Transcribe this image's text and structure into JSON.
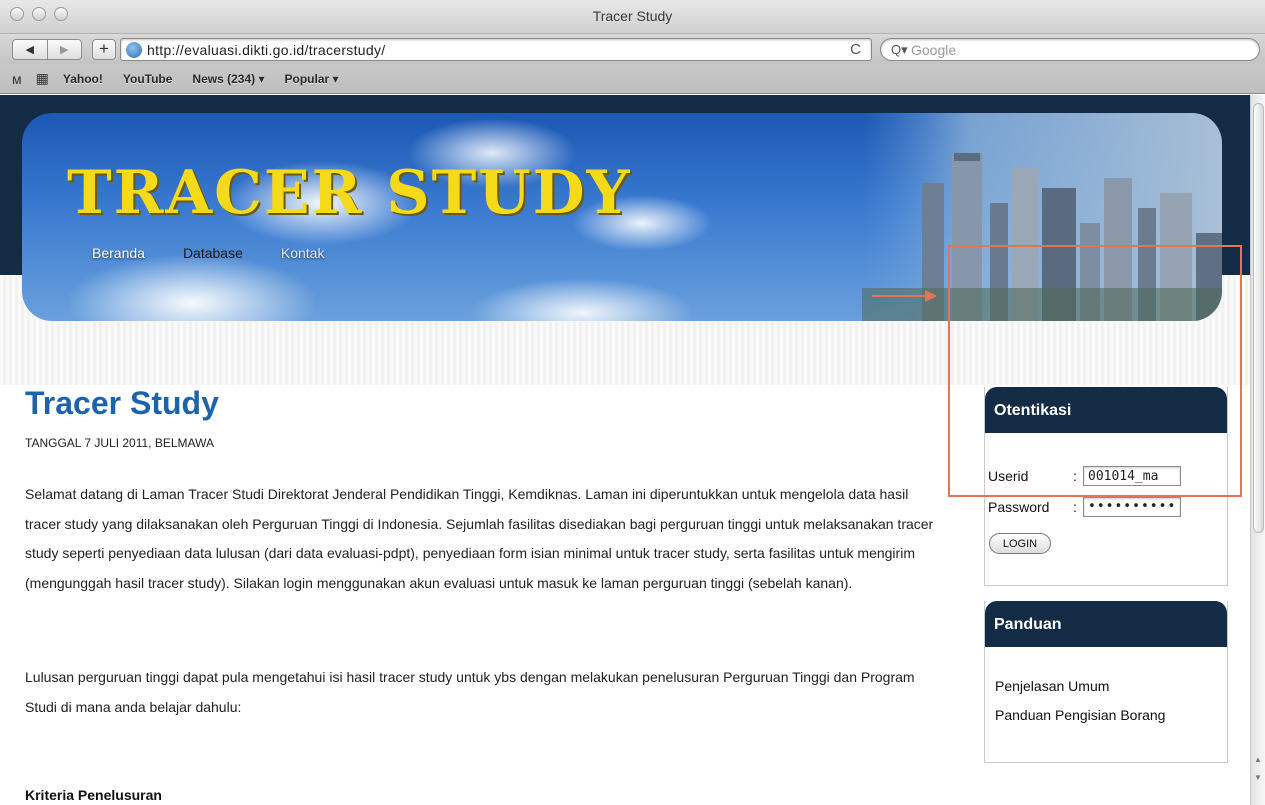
{
  "window": {
    "title": "Tracer Study"
  },
  "toolbar": {
    "back": "◀",
    "forward": "▶",
    "add": "+",
    "url": "http://evaluasi.dikti.go.id/tracerstudy/",
    "reload": "C",
    "search_icon": "Q▾",
    "search_placeholder": "Google"
  },
  "bookmarks": {
    "items": [
      "Yahoo!",
      "YouTube",
      "News (234) ▾",
      "Popular ▾"
    ]
  },
  "site": {
    "title": "TRACER STUDY",
    "nav": [
      "Beranda",
      "Database",
      "Kontak"
    ]
  },
  "main": {
    "heading": "Tracer Study",
    "meta": "TANGGAL 7 JULI 2011, BELMAWA",
    "paragraph1": "Selamat datang di Laman Tracer Studi Direktorat Jenderal Pendidikan Tinggi, Kemdiknas. Laman ini diperuntukkan untuk mengelola data hasil tracer study yang dilaksanakan oleh Perguruan Tinggi di Indonesia. Sejumlah fasilitas disediakan bagi perguruan tinggi untuk melaksanakan tracer study seperti penyediaan data lulusan (dari data evaluasi-pdpt), penyediaan form isian minimal untuk tracer study, serta fasilitas untuk mengirim (mengunggah hasil tracer study). Silakan login menggunakan akun evaluasi untuk masuk ke laman perguruan tinggi (sebelah kanan).",
    "paragraph2": "Lulusan perguruan tinggi dapat pula mengetahui isi hasil tracer study untuk ybs dengan melakukan penelusuran Perguruan Tinggi dan Program Studi di mana anda belajar dahulu:",
    "section_heading": "Kriteria Penelusuran"
  },
  "sidebar": {
    "auth": {
      "title": "Otentikasi",
      "userid_label": "Userid",
      "password_label": "Password",
      "colon": ":",
      "userid_value": "001014_ma",
      "password_value": "••••••••••",
      "login_label": "LOGIN"
    },
    "guide": {
      "title": "Panduan",
      "links": [
        "Penjelasan Umum",
        "Panduan Pengisian Borang"
      ]
    }
  },
  "colors": {
    "navy": "#142b45",
    "title_yellow": "#f5da1a",
    "heading_blue": "#1b64ad",
    "annotation": "#e57259"
  }
}
